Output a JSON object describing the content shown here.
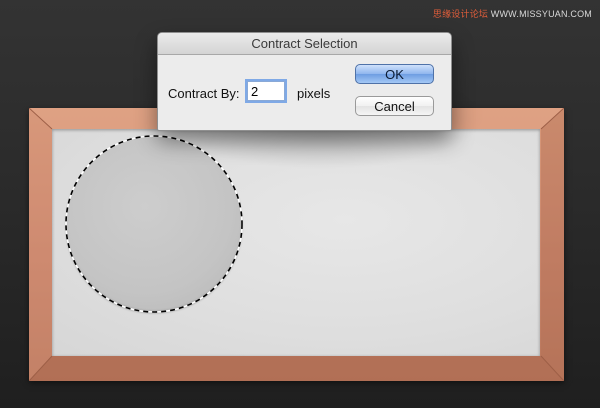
{
  "watermark": {
    "text": "思缘设计论坛",
    "site": "WWW.MISSYUAN.COM"
  },
  "dialog": {
    "title": "Contract Selection",
    "contract_label": "Contract By:",
    "contract_value": "2",
    "unit_label": "pixels",
    "ok_label": "OK",
    "cancel_label": "Cancel"
  },
  "colors": {
    "frame": "#c9846a",
    "canvas": "#dedede",
    "plate": "#c4c4c4",
    "ok_button": "#8fb6ee",
    "background": "#2c2c2c"
  }
}
